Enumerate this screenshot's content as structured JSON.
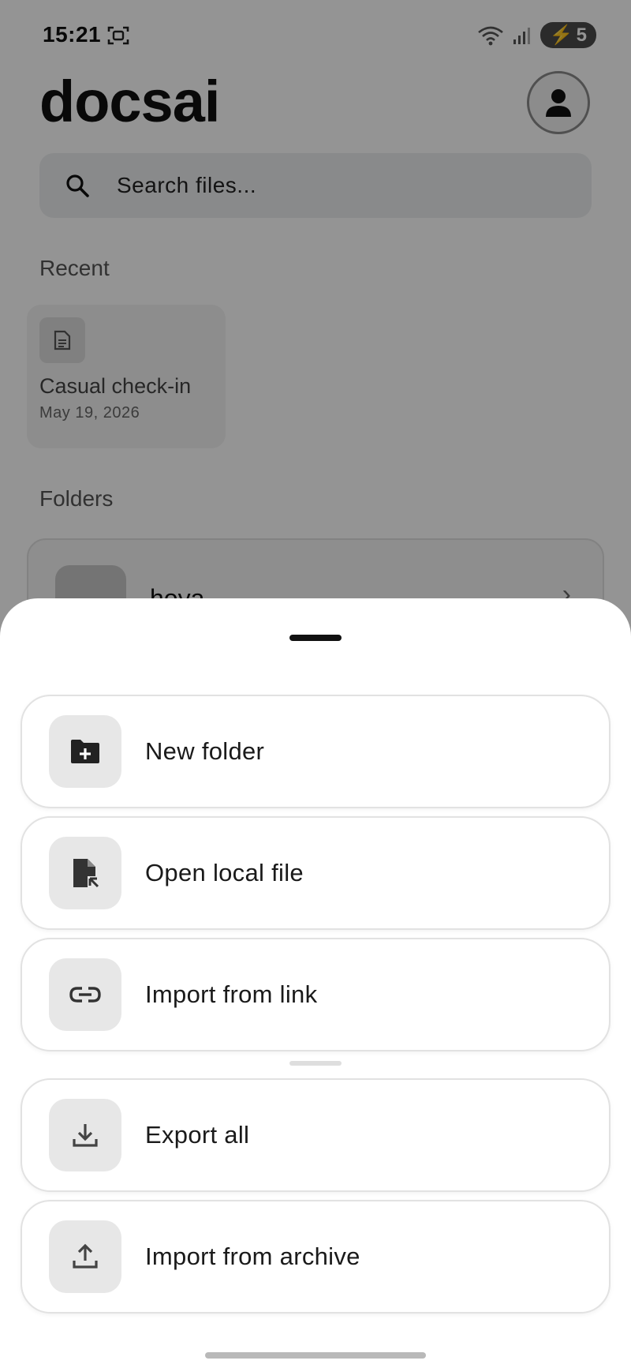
{
  "status_bar": {
    "time": "15:21",
    "battery": "5"
  },
  "header": {
    "title": "docsai"
  },
  "search": {
    "placeholder": "Search files..."
  },
  "recent": {
    "label": "Recent",
    "items": [
      {
        "title": "Casual check-in",
        "date": "May 19, 2026"
      }
    ]
  },
  "folders": {
    "label": "Folders",
    "items": [
      {
        "name": "hoya"
      }
    ]
  },
  "sheet": {
    "options": [
      {
        "label": "New folder",
        "icon": "new-folder-icon"
      },
      {
        "label": "Open local file",
        "icon": "open-file-icon"
      },
      {
        "label": "Import from link",
        "icon": "link-icon"
      },
      {
        "label": "Export all",
        "icon": "download-icon"
      },
      {
        "label": "Import from archive",
        "icon": "upload-icon"
      }
    ]
  }
}
